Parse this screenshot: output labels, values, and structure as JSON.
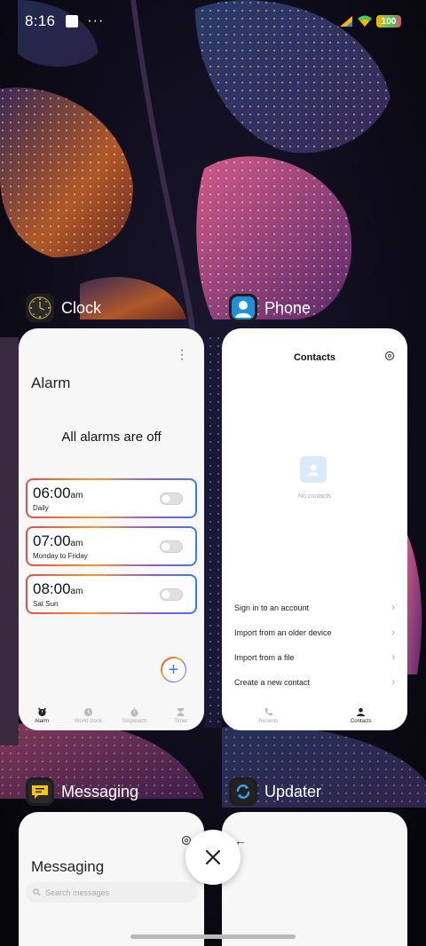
{
  "status_bar": {
    "time": "8:16",
    "overflow": "···",
    "battery_level": "100"
  },
  "apps": {
    "clock": {
      "name": "Clock",
      "title": "Alarm",
      "status": "All alarms are off",
      "alarms": [
        {
          "time": "06:00",
          "ampm": "am",
          "days": "Daily",
          "enabled": false
        },
        {
          "time": "07:00",
          "ampm": "am",
          "days": "Monday to Friday",
          "enabled": false
        },
        {
          "time": "08:00",
          "ampm": "am",
          "days": "Sat Sun",
          "enabled": false
        }
      ],
      "nav": [
        {
          "label": "Alarm",
          "icon": "alarm-icon",
          "active": true
        },
        {
          "label": "World clock",
          "icon": "world-clock-icon",
          "active": false
        },
        {
          "label": "Stopwatch",
          "icon": "stopwatch-icon",
          "active": false
        },
        {
          "label": "Timer",
          "icon": "timer-icon",
          "active": false
        }
      ]
    },
    "phone": {
      "name": "Phone",
      "title": "Contacts",
      "empty_text": "No contacts",
      "options": [
        "Sign in to an account",
        "Import from an older device",
        "Import from a file",
        "Create a new contact"
      ],
      "nav": [
        {
          "label": "Recents",
          "icon": "phone-icon",
          "active": false
        },
        {
          "label": "Contacts",
          "icon": "person-icon",
          "active": true
        }
      ]
    },
    "messaging": {
      "name": "Messaging",
      "title": "Messaging",
      "search_placeholder": "Search messages"
    },
    "updater": {
      "name": "Updater"
    }
  },
  "colors": {
    "accent_blue": "#3c7de8",
    "gradient_red": "#e84a4a",
    "gradient_orange": "#f09a2a",
    "gradient_purple": "#8a5ad8"
  }
}
